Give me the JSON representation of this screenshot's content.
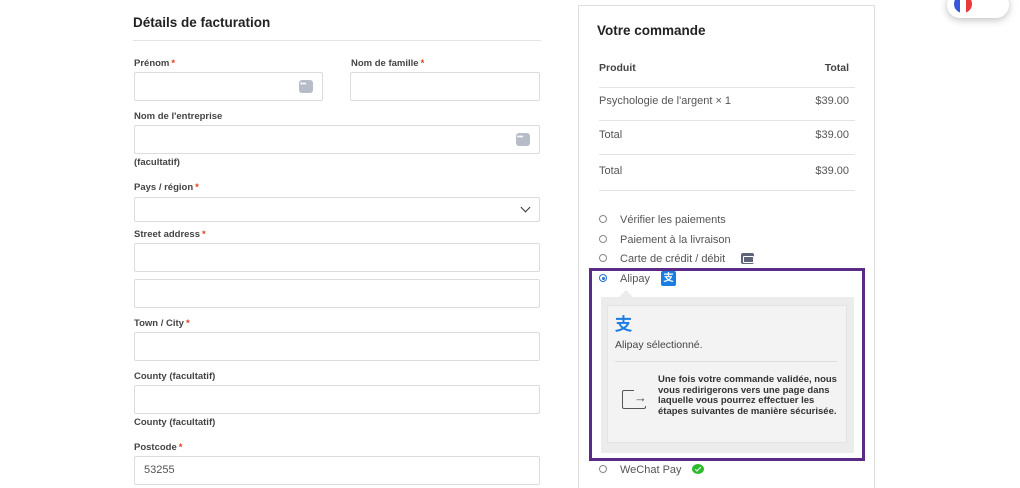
{
  "billing": {
    "title": "Détails de facturation",
    "first_name_label": "Prénom",
    "last_name_label": "Nom de famille",
    "company_label": "Nom de l'entreprise",
    "company_note": "(facultatif)",
    "country_label": "Pays / région",
    "street_label": "Street address",
    "city_label": "Town / City",
    "county_label": "County (facultatif)",
    "county_note": "County (facultatif)",
    "postcode_label": "Postcode",
    "postcode_value": "53255",
    "required_mark": "*"
  },
  "order": {
    "title": "Votre commande",
    "head_product": "Produit",
    "head_total": "Total",
    "item_name": "Psychologie de l'argent × 1",
    "item_price": "$39.00",
    "subtotal_label": "Total",
    "subtotal_value": "$39.00",
    "total_label": "Total",
    "total_value": "$39.00"
  },
  "payment": {
    "methods": [
      {
        "label": "Vérifier les paiements",
        "selected": false
      },
      {
        "label": "Paiement à la livraison",
        "selected": false
      },
      {
        "label": "Carte de crédit / débit",
        "selected": false,
        "icon": "credit-card-icon"
      },
      {
        "label": "Alipay",
        "selected": true,
        "icon": "alipay-icon"
      },
      {
        "label": "WeChat Pay",
        "selected": false,
        "icon": "wechat-icon"
      }
    ],
    "alipay_glyph": "支",
    "alipay_selected_text": "Alipay sélectionné.",
    "redirect_text": "Une fois votre commande validée, nous vous redirigerons vers une page dans laquelle vous pourrez effectuer les étapes suivantes de manière sécurisée.",
    "highlight_color": "#5b2a86"
  },
  "colors": {
    "required": "#e2401c",
    "alipay_blue": "#1a7de3",
    "wechat_green": "#2dbb2d"
  }
}
